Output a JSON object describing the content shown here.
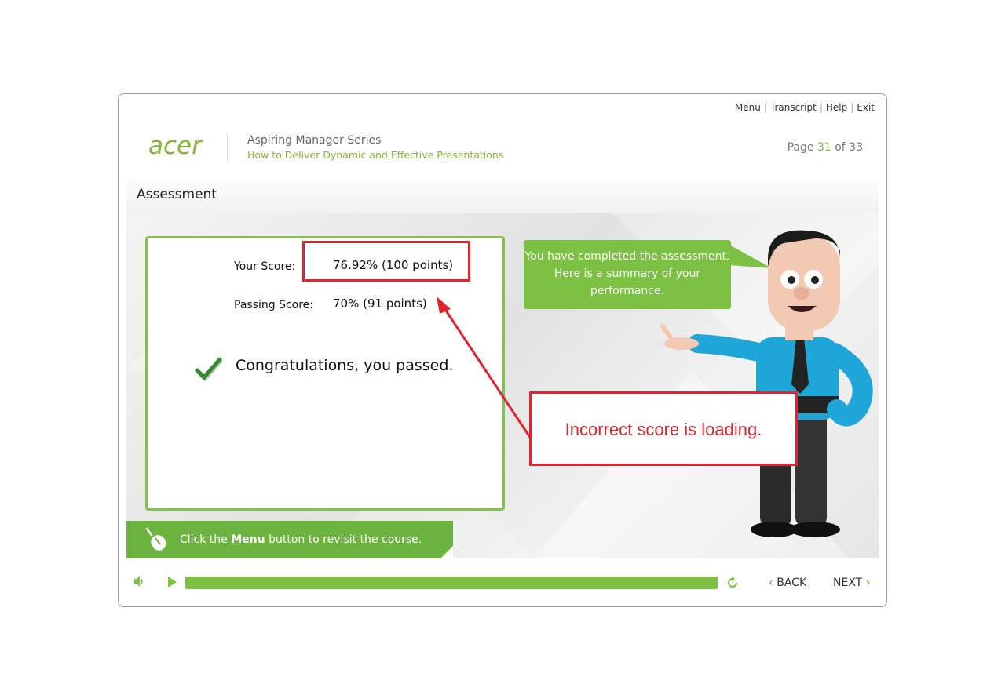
{
  "topnav": {
    "menu": "Menu",
    "transcript": "Transcript",
    "help": "Help",
    "exit": "Exit"
  },
  "header": {
    "logo": "acer",
    "series": "Aspiring Manager Series",
    "course": "How to Deliver Dynamic and Effective Presentations",
    "page_prefix": "Page",
    "page_current": "31",
    "page_of": "of 33"
  },
  "section_title": "Assessment",
  "score": {
    "your_label": "Your Score:",
    "your_value": "76.92% (100 points)",
    "passing_label": "Passing Score:",
    "passing_value": "70% (91 points)",
    "result": "Congratulations, you passed."
  },
  "bubble": "You have completed the assessment. Here is a summary of your performance.",
  "hint": {
    "pre": "Click the",
    "bold": "Menu",
    "post": "button to revisit the course."
  },
  "annotation": "Incorrect score is loading.",
  "controls": {
    "back": "BACK",
    "next": "NEXT",
    "progress": 1.0
  },
  "colors": {
    "accent": "#7cc143",
    "annotation": "#e0242c"
  }
}
